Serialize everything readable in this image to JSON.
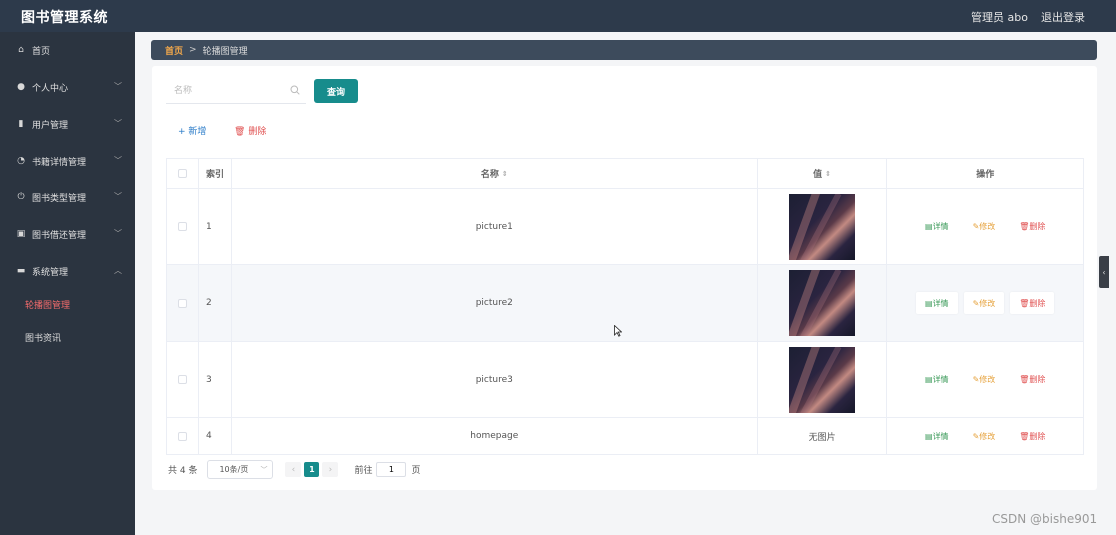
{
  "header": {
    "title": "图书管理系统",
    "admin": "管理员 abo",
    "logout": "退出登录"
  },
  "sidebar": {
    "items": [
      {
        "label": "首页",
        "icon": "home-icon",
        "glyph": "⌂"
      },
      {
        "label": "个人中心",
        "icon": "user-icon",
        "glyph": "●"
      },
      {
        "label": "用户管理",
        "icon": "bar-chart-icon",
        "glyph": "▮"
      },
      {
        "label": "书籍详情管理",
        "icon": "dashboard-icon",
        "glyph": "◔"
      },
      {
        "label": "图书类型管理",
        "icon": "power-icon",
        "glyph": "⏻"
      },
      {
        "label": "图书借还管理",
        "icon": "chart-box-icon",
        "glyph": "▣"
      },
      {
        "label": "系统管理",
        "icon": "comment-icon",
        "glyph": "▬"
      }
    ],
    "sub_items": [
      {
        "label": "轮播图管理",
        "active": true
      },
      {
        "label": "图书资讯",
        "active": false
      }
    ]
  },
  "breadcrumb": {
    "home": "首页",
    "separator": ">",
    "current": "轮播图管理"
  },
  "search": {
    "placeholder": "名称",
    "value": "",
    "button": "查询"
  },
  "actions": {
    "add": "+ 新增",
    "delete": "删除"
  },
  "table": {
    "headers": {
      "index": "索引",
      "name": "名称",
      "value": "值",
      "ops": "操作"
    },
    "rows": [
      {
        "index": "1",
        "name": "picture1",
        "value_text": ""
      },
      {
        "index": "2",
        "name": "picture2",
        "value_text": ""
      },
      {
        "index": "3",
        "name": "picture3",
        "value_text": ""
      },
      {
        "index": "4",
        "name": "homepage",
        "value_text": "无图片"
      }
    ],
    "ops": {
      "detail": "详情",
      "edit": "修改",
      "remove": "删除"
    }
  },
  "pagination": {
    "total": "共 4 条",
    "page_size": "10条/页",
    "current_page": "1",
    "goto_prefix": "前往",
    "goto_value": "1",
    "goto_suffix": "页"
  },
  "watermark": "CSDN @bishe901",
  "colors": {
    "header_bg": "#2d3a4b",
    "sidebar_bg": "#2b3440",
    "accent_teal": "#178c8c",
    "active_menu": "#f56c6c",
    "breadcrumb_home": "#f2a84b"
  }
}
